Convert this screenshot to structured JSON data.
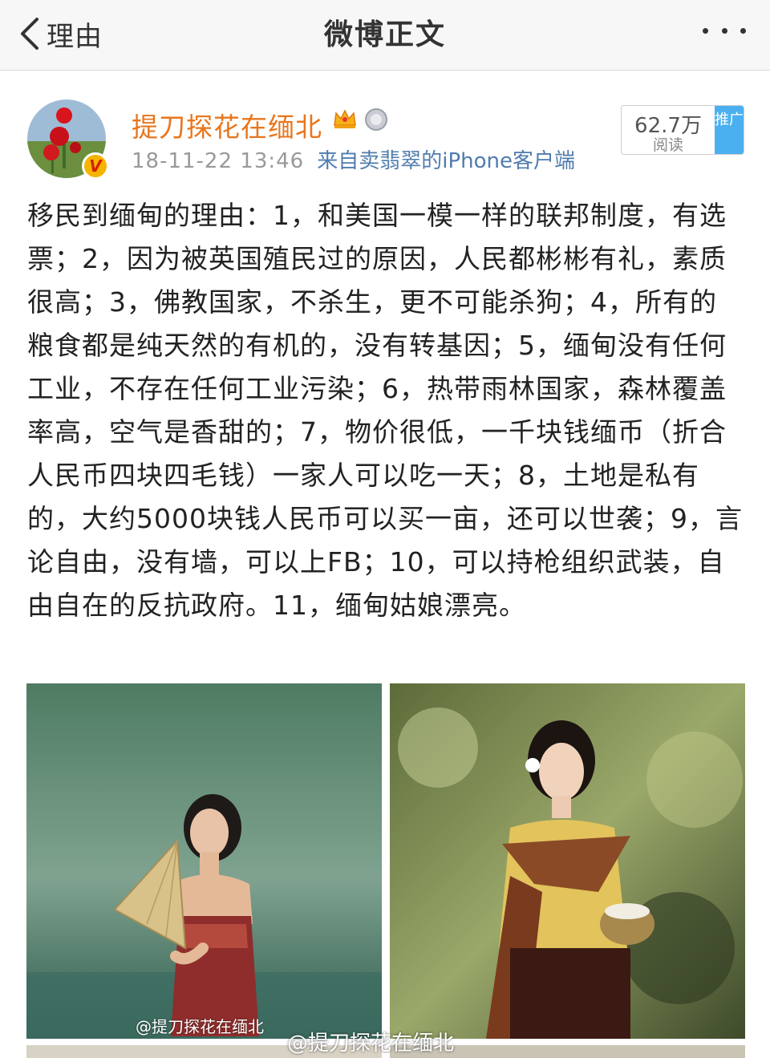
{
  "nav": {
    "back_label": "理由",
    "title": "微博正文"
  },
  "post": {
    "user_name": "提刀探花在缅北",
    "time": "18-11-22 13:46",
    "source": "来自卖翡翠的iPhone客户端",
    "read_count": "62.7万",
    "read_label": "阅读",
    "promote_label": "推广",
    "text": "移民到缅甸的理由：1，和美国一模一样的联邦制度，有选票；2，因为被英国殖民过的原因，人民都彬彬有礼，素质很高；3，佛教国家，不杀生，更不可能杀狗；4，所有的粮食都是纯天然的有机的，没有转基因；5，缅甸没有任何工业，不存在任何工业污染；6，热带雨林国家，森林覆盖率高，空气是香甜的；7，物价很低，一千块钱缅币（折合人民币四块四毛钱）一家人可以吃一天；8，土地是私有的，大约5000块钱人民币可以买一亩，还可以世袭；9，言论自由，没有墙，可以上FB；10，可以持枪组织武装，自由自在的反抗政府。11，缅甸姑娘漂亮。",
    "image_watermark": "@提刀探花在缅北",
    "page_watermark": "@提刀探花在缅北"
  },
  "icons": {
    "back": "chevron-left-icon",
    "more": "more-dots-icon",
    "crown": "vip-crown-icon",
    "medal": "medal-icon",
    "verify": "verified-v-icon"
  },
  "colors": {
    "username": "#e8761d",
    "source_link": "#4f7cae",
    "promote": "#4bb0f0"
  }
}
